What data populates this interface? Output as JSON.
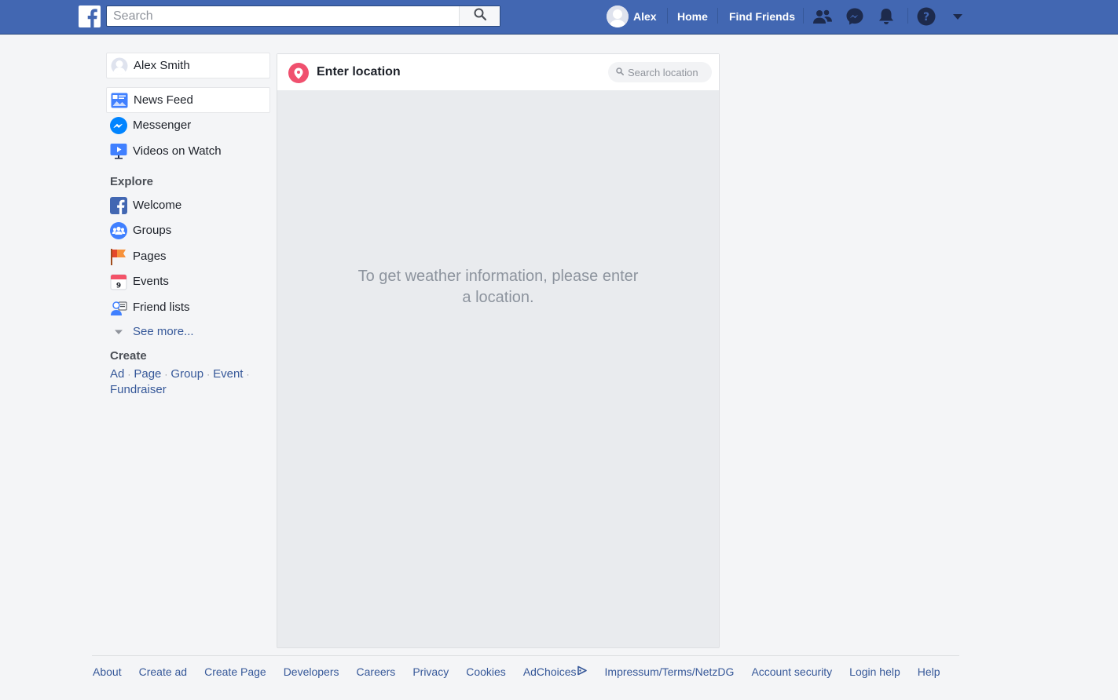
{
  "topbar": {
    "search_placeholder": "Search",
    "user_name": "Alex",
    "home_label": "Home",
    "find_friends_label": "Find Friends",
    "icons": [
      "friend-requests-icon",
      "messenger-icon",
      "notifications-icon",
      "help-icon",
      "account-menu-icon"
    ],
    "brand_color": "#4267b2"
  },
  "sidebar": {
    "profile_name": "Alex Smith",
    "items": [
      {
        "label": "News Feed",
        "icon": "news-feed-icon"
      },
      {
        "label": "Messenger",
        "icon": "messenger-icon"
      },
      {
        "label": "Videos on Watch",
        "icon": "watch-icon"
      }
    ],
    "explore_title": "Explore",
    "explore_items": [
      {
        "label": "Welcome",
        "icon": "facebook-icon"
      },
      {
        "label": "Groups",
        "icon": "groups-icon"
      },
      {
        "label": "Pages",
        "icon": "flag-icon"
      },
      {
        "label": "Events",
        "icon": "calendar-icon"
      },
      {
        "label": "Friend lists",
        "icon": "friend-list-icon"
      }
    ],
    "see_more": "See more...",
    "create_title": "Create",
    "create_links": [
      "Ad",
      "Page",
      "Group",
      "Event",
      "Fundraiser"
    ]
  },
  "main": {
    "title": "Enter location",
    "search_placeholder": "Search location",
    "message": "To get weather information, please enter a location.",
    "pin_color": "#f0506e"
  },
  "footer": {
    "links": [
      "About",
      "Create ad",
      "Create Page",
      "Developers",
      "Careers",
      "Privacy",
      "Cookies",
      "AdChoices",
      "Impressum/Terms/NetzDG",
      "Account security",
      "Login help",
      "Help"
    ]
  }
}
